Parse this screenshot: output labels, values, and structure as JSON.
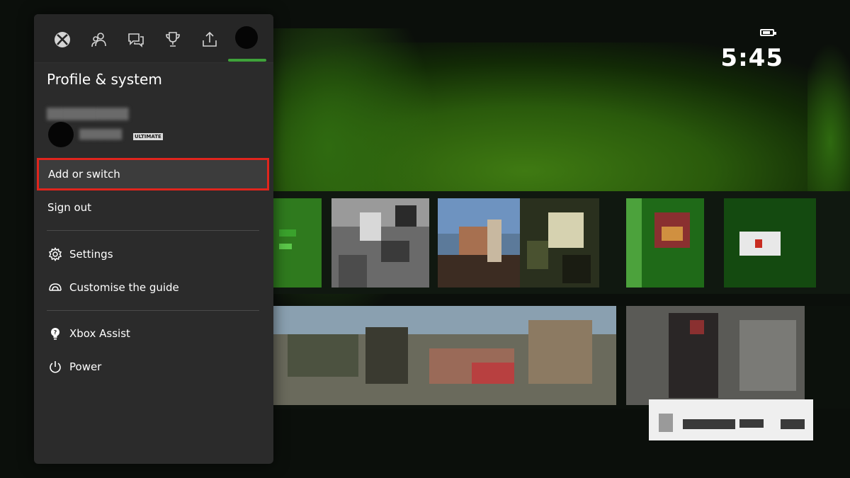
{
  "status": {
    "time": "5:45",
    "battery_icon": "battery-icon"
  },
  "guide": {
    "tabs": [
      {
        "icon": "xbox-logo-icon"
      },
      {
        "icon": "people-icon"
      },
      {
        "icon": "chat-icon"
      },
      {
        "icon": "trophy-icon"
      },
      {
        "icon": "share-icon"
      },
      {
        "icon": "profile-avatar-icon"
      }
    ],
    "active_tab_index": 5,
    "title": "Profile & system",
    "profile": {
      "badge": "ULTIMATE"
    },
    "menu": {
      "add_or_switch": "Add or switch",
      "sign_out": "Sign out",
      "settings": "Settings",
      "customise_the_guide": "Customise the guide",
      "xbox_assist": "Xbox Assist",
      "power": "Power"
    },
    "selected_item": "Add or switch",
    "colors": {
      "panel_bg": "#2b2b2b",
      "highlight_border": "#e0251d",
      "tab_indicator": "#3fa23a",
      "text": "#ffffff"
    }
  }
}
